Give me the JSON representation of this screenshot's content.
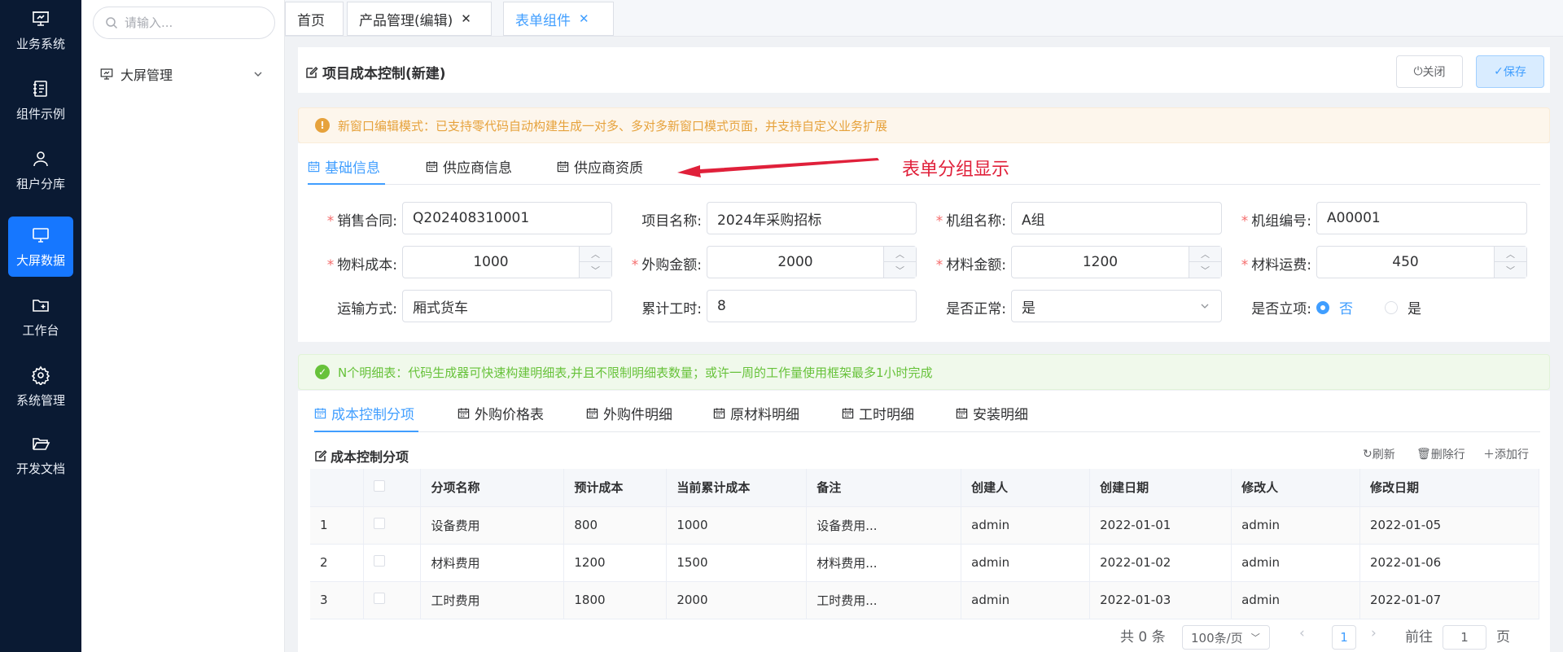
{
  "rail": {
    "items": [
      {
        "label": "业务系统",
        "icon": "presentation-icon"
      },
      {
        "label": "组件示例",
        "icon": "notebook-icon"
      },
      {
        "label": "租户分库",
        "icon": "user-icon"
      },
      {
        "label": "大屏数据",
        "icon": "monitor-icon"
      },
      {
        "label": "工作台",
        "icon": "folder-plus-icon"
      },
      {
        "label": "系统管理",
        "icon": "gear-icon"
      },
      {
        "label": "开发文档",
        "icon": "folder-open-icon"
      }
    ],
    "active": "大屏数据"
  },
  "sidebar": {
    "search_placeholder": "请输入...",
    "tree_item": "大屏管理"
  },
  "tabs": [
    {
      "label": "首页"
    },
    {
      "label": "产品管理(编辑)"
    },
    {
      "label": "表单组件"
    }
  ],
  "header": {
    "title": "项目成本控制(新建)",
    "close_label": "关闭",
    "save_label": "保存"
  },
  "alerts": {
    "warn": "新窗口编辑模式：已支持零代码自动构建生成一对多、多对多新窗口模式页面，并支持自定义业务扩展",
    "ok": "N个明细表：代码生成器可快速构建明细表,并且不限制明细表数量；或许一周的工作量使用框架最多1小时完成"
  },
  "group_tabs": [
    "基础信息",
    "供应商信息",
    "供应商资质"
  ],
  "annotation": "表单分组显示",
  "form": {
    "sales_contract": {
      "label": "销售合同:",
      "value": "Q202408310001"
    },
    "project_name": {
      "label": "项目名称:",
      "value": "2024年采购招标"
    },
    "unit_name": {
      "label": "机组名称:",
      "value": "A组"
    },
    "unit_no": {
      "label": "机组编号:",
      "value": "A00001"
    },
    "material_cost": {
      "label": "物料成本:",
      "value": "1000"
    },
    "purchase_amount": {
      "label": "外购金额:",
      "value": "2000"
    },
    "material_amount": {
      "label": "材料金额:",
      "value": "1200"
    },
    "material_freight": {
      "label": "材料运费:",
      "value": "450"
    },
    "transport": {
      "label": "运输方式:",
      "value": "厢式货车"
    },
    "hours": {
      "label": "累计工时:",
      "value": "8"
    },
    "normal": {
      "label": "是否正常:",
      "value": "是"
    },
    "approved": {
      "label": "是否立项:",
      "options": [
        "否",
        "是"
      ],
      "selected": "否"
    }
  },
  "detail_tabs": [
    "成本控制分项",
    "外购价格表",
    "外购件明细",
    "原材料明细",
    "工时明细",
    "安装明细"
  ],
  "detail": {
    "title": "成本控制分项",
    "refresh": "刷新",
    "delete_row": "删除行",
    "add_row": "添加行",
    "columns": [
      "分项名称",
      "预计成本",
      "当前累计成本",
      "备注",
      "创建人",
      "创建日期",
      "修改人",
      "修改日期"
    ],
    "rows": [
      [
        "1",
        "设备费用",
        "800",
        "1000",
        "设备费用...",
        "admin",
        "2022-01-01",
        "admin",
        "2022-01-05"
      ],
      [
        "2",
        "材料费用",
        "1200",
        "1500",
        "材料费用...",
        "admin",
        "2022-01-02",
        "admin",
        "2022-01-06"
      ],
      [
        "3",
        "工时费用",
        "1800",
        "2000",
        "工时费用...",
        "admin",
        "2022-01-03",
        "admin",
        "2022-01-07"
      ]
    ]
  },
  "pager": {
    "total": "共 0 条",
    "page_size": "100条/页",
    "current_page": "1",
    "goto_label": "前往",
    "goto_value": "1",
    "page_unit": "页"
  },
  "colors": {
    "rail_bg": "#0a1a33",
    "rail_active": "#1677ff",
    "primary": "#409eff",
    "annotation": "#e0203a"
  }
}
